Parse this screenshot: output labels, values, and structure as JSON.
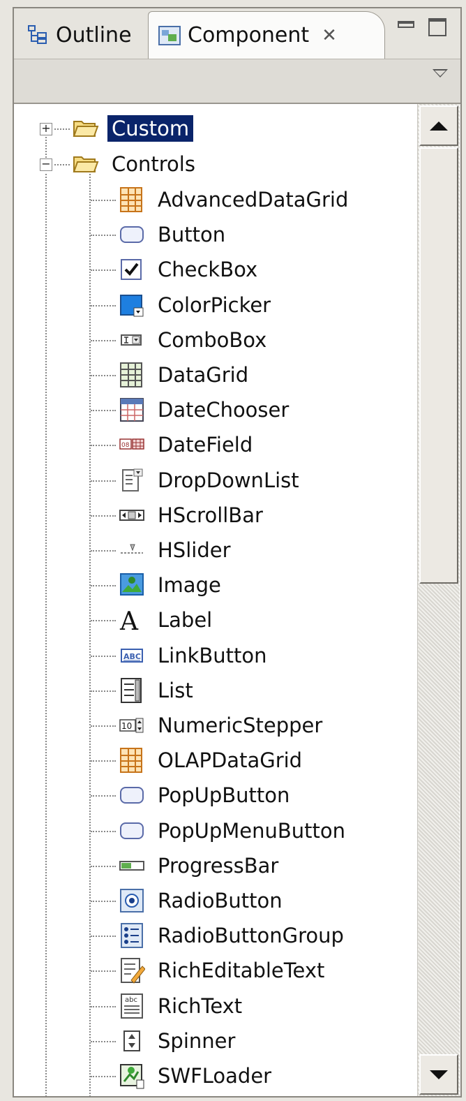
{
  "tabs": {
    "outline": {
      "label": "Outline",
      "icon": "outline-icon"
    },
    "component": {
      "label": "Component",
      "icon": "component-icon",
      "active": true
    }
  },
  "tree": {
    "custom": {
      "label": "Custom",
      "selected": true,
      "expanded": false
    },
    "controls": {
      "label": "Controls",
      "expanded": true
    },
    "items": [
      {
        "label": "AdvancedDataGrid",
        "icon": "advanced-data-grid-icon"
      },
      {
        "label": "Button",
        "icon": "button-icon"
      },
      {
        "label": "CheckBox",
        "icon": "checkbox-icon"
      },
      {
        "label": "ColorPicker",
        "icon": "color-picker-icon"
      },
      {
        "label": "ComboBox",
        "icon": "combobox-icon"
      },
      {
        "label": "DataGrid",
        "icon": "data-grid-icon"
      },
      {
        "label": "DateChooser",
        "icon": "date-chooser-icon"
      },
      {
        "label": "DateField",
        "icon": "date-field-icon"
      },
      {
        "label": "DropDownList",
        "icon": "drop-down-list-icon"
      },
      {
        "label": "HScrollBar",
        "icon": "hscrollbar-icon"
      },
      {
        "label": "HSlider",
        "icon": "hslider-icon"
      },
      {
        "label": "Image",
        "icon": "image-icon"
      },
      {
        "label": "Label",
        "icon": "label-icon"
      },
      {
        "label": "LinkButton",
        "icon": "link-button-icon"
      },
      {
        "label": "List",
        "icon": "list-icon"
      },
      {
        "label": "NumericStepper",
        "icon": "numeric-stepper-icon"
      },
      {
        "label": "OLAPDataGrid",
        "icon": "olap-data-grid-icon"
      },
      {
        "label": "PopUpButton",
        "icon": "popup-button-icon"
      },
      {
        "label": "PopUpMenuButton",
        "icon": "popup-menu-button-icon"
      },
      {
        "label": "ProgressBar",
        "icon": "progress-bar-icon"
      },
      {
        "label": "RadioButton",
        "icon": "radio-button-icon"
      },
      {
        "label": "RadioButtonGroup",
        "icon": "radio-button-group-icon"
      },
      {
        "label": "RichEditableText",
        "icon": "rich-editable-text-icon"
      },
      {
        "label": "RichText",
        "icon": "rich-text-icon"
      },
      {
        "label": "Spinner",
        "icon": "spinner-icon"
      },
      {
        "label": "SWFLoader",
        "icon": "swf-loader-icon"
      }
    ]
  },
  "colors": {
    "selection": "#0a246a",
    "folder": "#f2c84b"
  }
}
